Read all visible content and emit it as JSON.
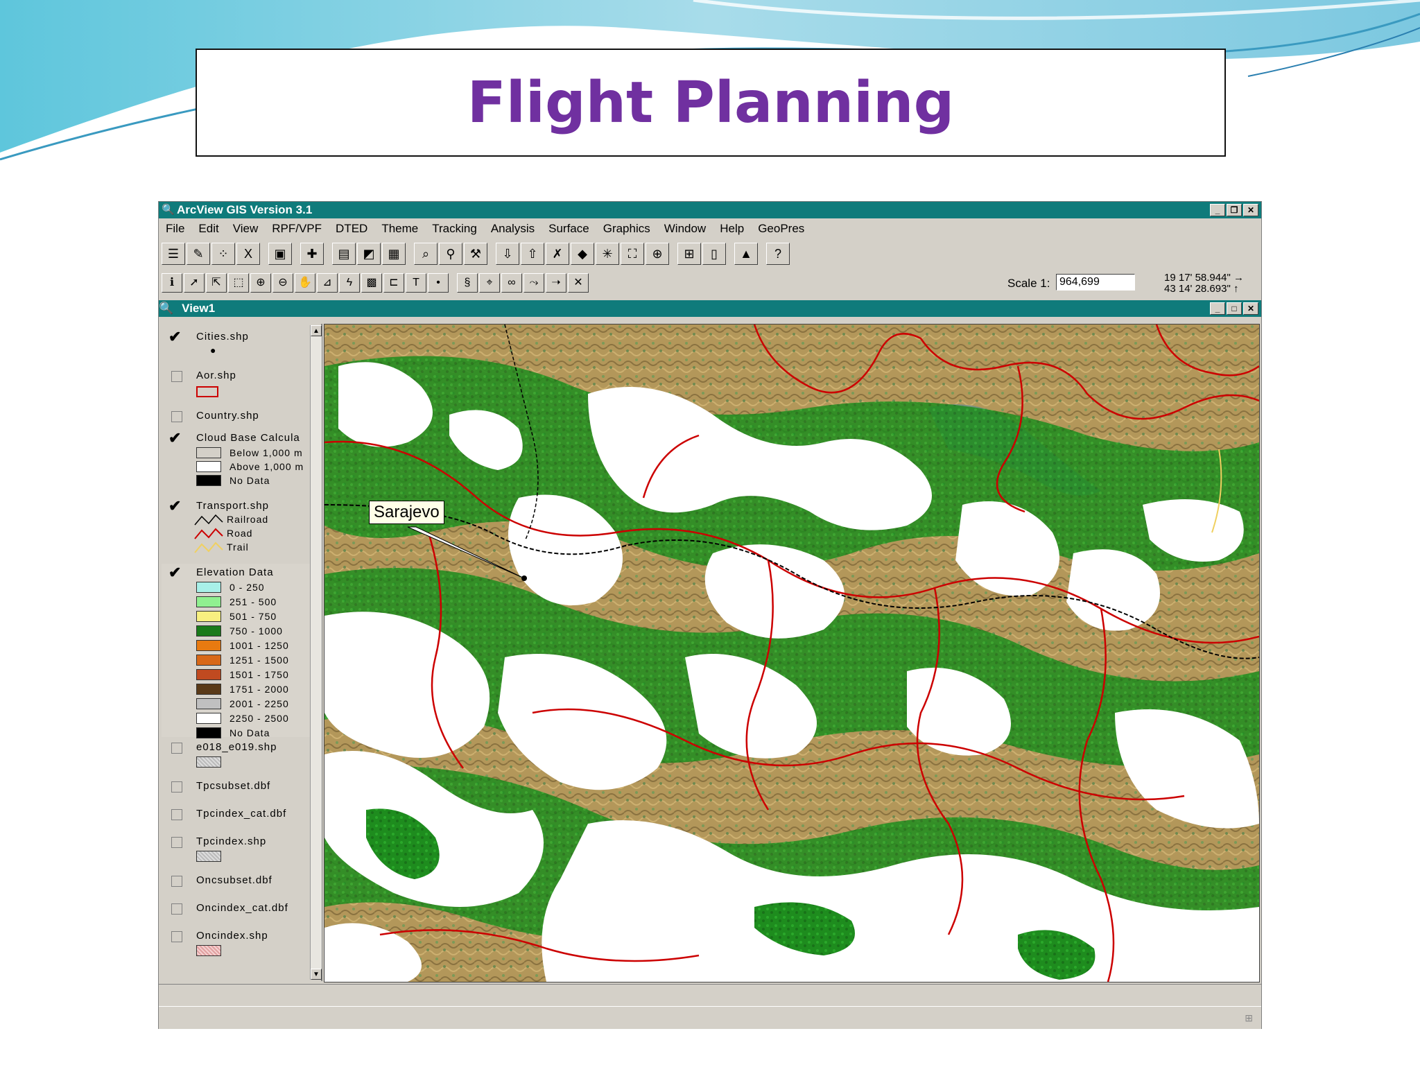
{
  "slide": {
    "title": "Flight Planning"
  },
  "app": {
    "title": "ArcView GIS Version 3.1",
    "menu": [
      "File",
      "Edit",
      "View",
      "RPF/VPF",
      "DTED",
      "Theme",
      "Tracking",
      "Analysis",
      "Surface",
      "Graphics",
      "Window",
      "Help",
      "GeoPres"
    ],
    "scale_label": "Scale  1:",
    "scale_value": "964,699",
    "coord_lon": "19 17' 58.944\"",
    "coord_lat": "43 14' 28.693\""
  },
  "view": {
    "title": "View1",
    "map_callout": "Sarajevo"
  },
  "toc": {
    "layers": [
      {
        "name": "Cities.shp",
        "checked": true
      },
      {
        "name": "Aor.shp",
        "checked": false
      },
      {
        "name": "Country.shp",
        "checked": false
      },
      {
        "name": "Cloud Base Calcula",
        "checked": true,
        "legend": [
          {
            "label": "Below 1,000 m",
            "color": "#d4d0c8"
          },
          {
            "label": "Above 1,000 m",
            "color": "#ffffff"
          },
          {
            "label": "No Data",
            "color": "#000000"
          }
        ]
      },
      {
        "name": "Transport.shp",
        "checked": true,
        "legend": [
          {
            "label": "Railroad",
            "color": "#000000"
          },
          {
            "label": "Road",
            "color": "#cc0000"
          },
          {
            "label": "Trail",
            "color": "#f0d060"
          }
        ]
      },
      {
        "name": "Elevation Data",
        "checked": true,
        "legend": [
          {
            "label": "0 - 250",
            "color": "#a8f0e8"
          },
          {
            "label": "251 - 500",
            "color": "#90f090"
          },
          {
            "label": "501 - 750",
            "color": "#f8f080"
          },
          {
            "label": "750 - 1000",
            "color": "#1a7a1a"
          },
          {
            "label": "1001 - 1250",
            "color": "#e87a10"
          },
          {
            "label": "1251 - 1500",
            "color": "#d86818"
          },
          {
            "label": "1501 - 1750",
            "color": "#c04a20"
          },
          {
            "label": "1751 - 2000",
            "color": "#5a3a18"
          },
          {
            "label": "2001 - 2250",
            "color": "#c0c0c0"
          },
          {
            "label": "2250 - 2500",
            "color": "#ffffff"
          },
          {
            "label": "No Data",
            "color": "#000000"
          }
        ]
      },
      {
        "name": "e018_e019.shp",
        "checked": false
      },
      {
        "name": "Tpcsubset.dbf",
        "checked": false
      },
      {
        "name": "Tpcindex_cat.dbf",
        "checked": false
      },
      {
        "name": "Tpcindex.shp",
        "checked": false
      },
      {
        "name": "Oncsubset.dbf",
        "checked": false
      },
      {
        "name": "Oncindex_cat.dbf",
        "checked": false
      },
      {
        "name": "Oncindex.shp",
        "checked": false
      }
    ]
  },
  "colors": {
    "titlebar": "#0f7b7b",
    "title_text": "#7030a0",
    "road": "#cc0000",
    "forest": "#1e8c1e"
  },
  "icons": [
    "info-icon",
    "pointer-icon",
    "vertex-icon",
    "select-box-icon",
    "zoom-in-icon",
    "zoom-out-icon",
    "pan-hand-icon",
    "measure-icon",
    "hotlink-icon",
    "area-icon",
    "label-icon",
    "text-icon",
    "point-icon"
  ]
}
